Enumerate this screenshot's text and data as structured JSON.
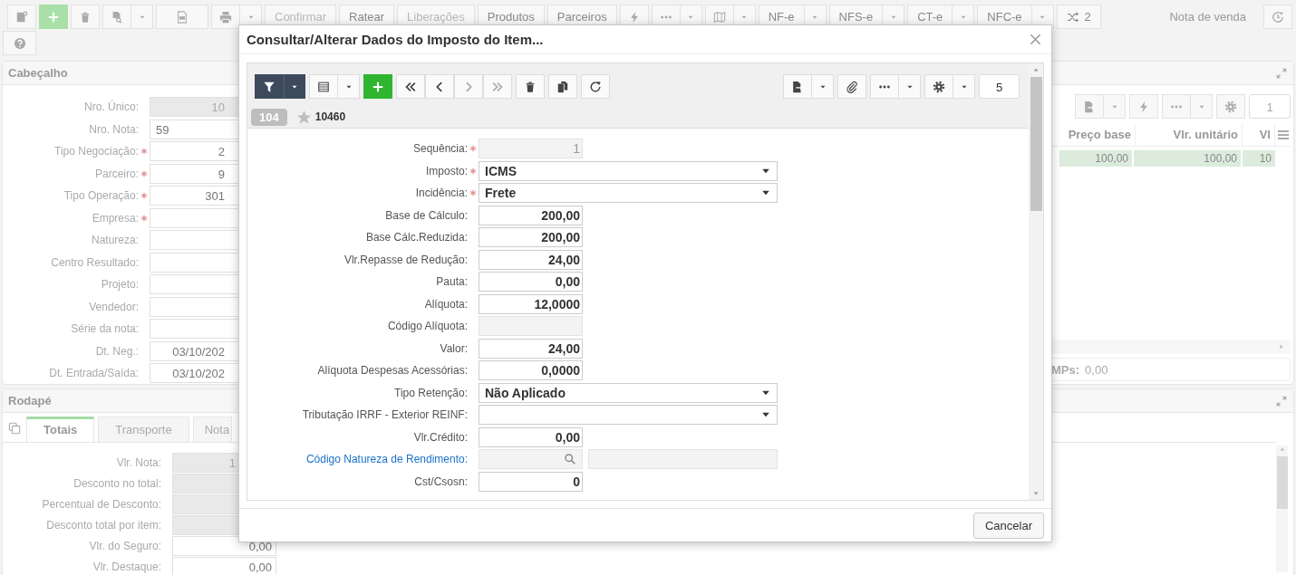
{
  "toolbar": {
    "text_buttons": [
      {
        "label": "Confirmar",
        "disabled": true
      },
      {
        "label": "Ratear",
        "disabled": false
      },
      {
        "label": "Liberações",
        "disabled": true
      },
      {
        "label": "Produtos",
        "disabled": false
      },
      {
        "label": "Parceiros",
        "disabled": false
      }
    ],
    "doc_buttons": [
      {
        "label": "NF-e"
      },
      {
        "label": "NFS-e"
      },
      {
        "label": "CT-e"
      },
      {
        "label": "NFC-e"
      }
    ],
    "shuffle_count": "2",
    "document_type": "Nota de venda"
  },
  "header_panel": {
    "title": "Cabeçalho",
    "fields": [
      {
        "label": "Nro. Único:",
        "required": false,
        "disabled": true,
        "kind": "number",
        "value": "10"
      },
      {
        "label": "Nro. Nota:",
        "required": false,
        "disabled": false,
        "kind": "text",
        "value": "59"
      },
      {
        "label": "Tipo Negociação:",
        "required": true,
        "disabled": false,
        "kind": "number",
        "value": "2"
      },
      {
        "label": "Parceiro:",
        "required": true,
        "disabled": false,
        "kind": "number",
        "value": "9"
      },
      {
        "label": "Tipo Operação:",
        "required": true,
        "disabled": false,
        "kind": "number",
        "value": "301"
      },
      {
        "label": "Empresa:",
        "required": true,
        "disabled": false,
        "kind": "number"
      },
      {
        "label": "Natureza:",
        "required": false,
        "disabled": false,
        "kind": "number"
      },
      {
        "label": "Centro Resultado:",
        "required": false,
        "disabled": false,
        "kind": "number"
      },
      {
        "label": "Projeto:",
        "required": false,
        "disabled": false,
        "kind": "number"
      },
      {
        "label": "Vendedor:",
        "required": false,
        "disabled": false,
        "kind": "number"
      },
      {
        "label": "Série da nota:",
        "required": false,
        "disabled": false,
        "kind": "number"
      },
      {
        "label": "Dt. Neg.:",
        "required": false,
        "disabled": false,
        "kind": "number",
        "value": "03/10/202"
      },
      {
        "label": "Dt. Entrada/Saída:",
        "required": false,
        "disabled": false,
        "kind": "number",
        "value": "03/10/202"
      }
    ],
    "grid": {
      "page_size": "1",
      "columns": [
        "Preço base",
        "Vlr. unitário",
        "Vl"
      ],
      "rows": [
        {
          "selected": true,
          "cells": [
            "100,00",
            "100,00",
            "10"
          ]
        }
      ],
      "footer_label": "MPs:",
      "footer_value": "0,00"
    }
  },
  "footer_panel": {
    "title": "Rodapé",
    "tabs": [
      {
        "label": "Totais",
        "selected": true
      },
      {
        "label": "Transporte",
        "selected": false
      },
      {
        "label": "Nota",
        "selected": false
      }
    ],
    "fields": [
      {
        "label": "Vlr. Nota:",
        "disabled": true,
        "value": "1"
      },
      {
        "label": "Desconto no total:",
        "disabled": true
      },
      {
        "label": "Percentual de Desconto:",
        "disabled": true
      },
      {
        "label": "Desconto total por item:",
        "disabled": true
      },
      {
        "label": "Vlr. do Seguro:",
        "disabled": false,
        "value": "0,00"
      },
      {
        "label": "Vlr. Destaque:",
        "disabled": false,
        "value": "0,00"
      }
    ]
  },
  "dialog": {
    "title": "Consultar/Alterar Dados do Imposto do Item...",
    "page_size": "5",
    "record_badge": "104",
    "record_code": "10460",
    "fields": [
      {
        "label": "Sequência:",
        "required": true,
        "disabled": true,
        "kind": "number",
        "value": "1"
      },
      {
        "label": "Imposto:",
        "required": true,
        "disabled": false,
        "kind": "select",
        "value": "ICMS"
      },
      {
        "label": "Incidência:",
        "required": true,
        "disabled": false,
        "kind": "select",
        "value": "Frete"
      },
      {
        "label": "Base de Cálculo:",
        "required": false,
        "disabled": false,
        "kind": "number",
        "value": "200,00"
      },
      {
        "label": "Base Cálc.Reduzida:",
        "required": false,
        "disabled": false,
        "kind": "number",
        "value": "200,00"
      },
      {
        "label": "Vlr.Repasse de Redução:",
        "required": false,
        "disabled": false,
        "kind": "number",
        "value": "24,00"
      },
      {
        "label": "Pauta:",
        "required": false,
        "disabled": false,
        "kind": "number",
        "value": "0,00"
      },
      {
        "label": "Alíquota:",
        "required": false,
        "disabled": false,
        "kind": "number",
        "value": "12,0000"
      },
      {
        "label": "Código Alíquota:",
        "required": false,
        "disabled": true,
        "kind": "number"
      },
      {
        "label": "Valor:",
        "required": false,
        "disabled": false,
        "kind": "number",
        "value": "24,00"
      },
      {
        "label": "Alíquota Despesas Acessórias:",
        "required": false,
        "disabled": false,
        "kind": "number",
        "value": "0,0000"
      },
      {
        "label": "Tipo Retenção:",
        "required": false,
        "disabled": false,
        "kind": "select",
        "value": "Não Aplicado"
      },
      {
        "label": "Tributação IRRF - Exterior REINF:",
        "required": false,
        "disabled": false,
        "kind": "select"
      },
      {
        "label": "Vlr.Crédito:",
        "required": false,
        "disabled": false,
        "kind": "number",
        "value": "0,00"
      },
      {
        "label": "Código Natureza de Rendimento:",
        "required": false,
        "disabled": true,
        "kind": "lookup",
        "link": true
      },
      {
        "label": "Cst/Csosn:",
        "required": false,
        "disabled": false,
        "kind": "number",
        "value": "0"
      }
    ],
    "cancel_label": "Cancelar"
  }
}
